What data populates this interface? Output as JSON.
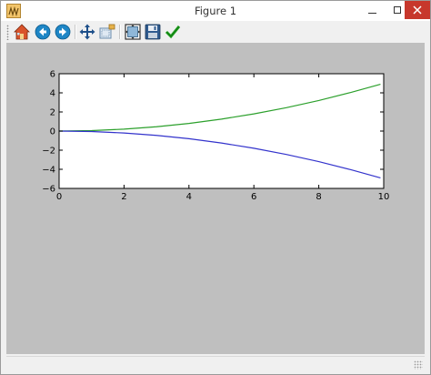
{
  "window": {
    "title": "Figure 1"
  },
  "toolbar": {
    "buttons": [
      {
        "name": "home-button",
        "icon": "home-icon"
      },
      {
        "name": "back-button",
        "icon": "back-arrow-icon"
      },
      {
        "name": "forward-button",
        "icon": "forward-arrow-icon"
      },
      {
        "name": "pan-button",
        "icon": "move-icon"
      },
      {
        "name": "zoom-button",
        "icon": "zoom-rect-icon"
      },
      {
        "name": "subplots-button",
        "icon": "subplots-icon"
      },
      {
        "name": "save-button",
        "icon": "floppy-disk-icon"
      },
      {
        "name": "edit-axis-button",
        "icon": "checkmark-icon"
      }
    ]
  },
  "colors": {
    "canvas_bg": "#bfbfbf",
    "axes_bg": "#ffffff",
    "series_upper": "#2ca02c",
    "series_lower": "#3333cc"
  },
  "chart_data": {
    "type": "line",
    "title": "",
    "xlabel": "",
    "ylabel": "",
    "xlim": [
      0,
      10
    ],
    "ylim": [
      -6,
      6
    ],
    "x_ticks": [
      "0",
      "2",
      "4",
      "6",
      "8",
      "10"
    ],
    "y_ticks": [
      "6",
      "4",
      "2",
      "0",
      "−2",
      "−4",
      "−6"
    ],
    "grid": false,
    "x": [
      0,
      1,
      2,
      3,
      4,
      5,
      6,
      7,
      8,
      9,
      9.9
    ],
    "series": [
      {
        "color": "#2ca02c",
        "values": [
          0,
          0.05,
          0.2,
          0.45,
          0.8,
          1.25,
          1.8,
          2.45,
          3.2,
          4.05,
          4.9
        ]
      },
      {
        "color": "#3333cc",
        "values": [
          0,
          -0.05,
          -0.2,
          -0.45,
          -0.8,
          -1.25,
          -1.8,
          -2.45,
          -3.2,
          -4.05,
          -4.9
        ]
      }
    ]
  }
}
